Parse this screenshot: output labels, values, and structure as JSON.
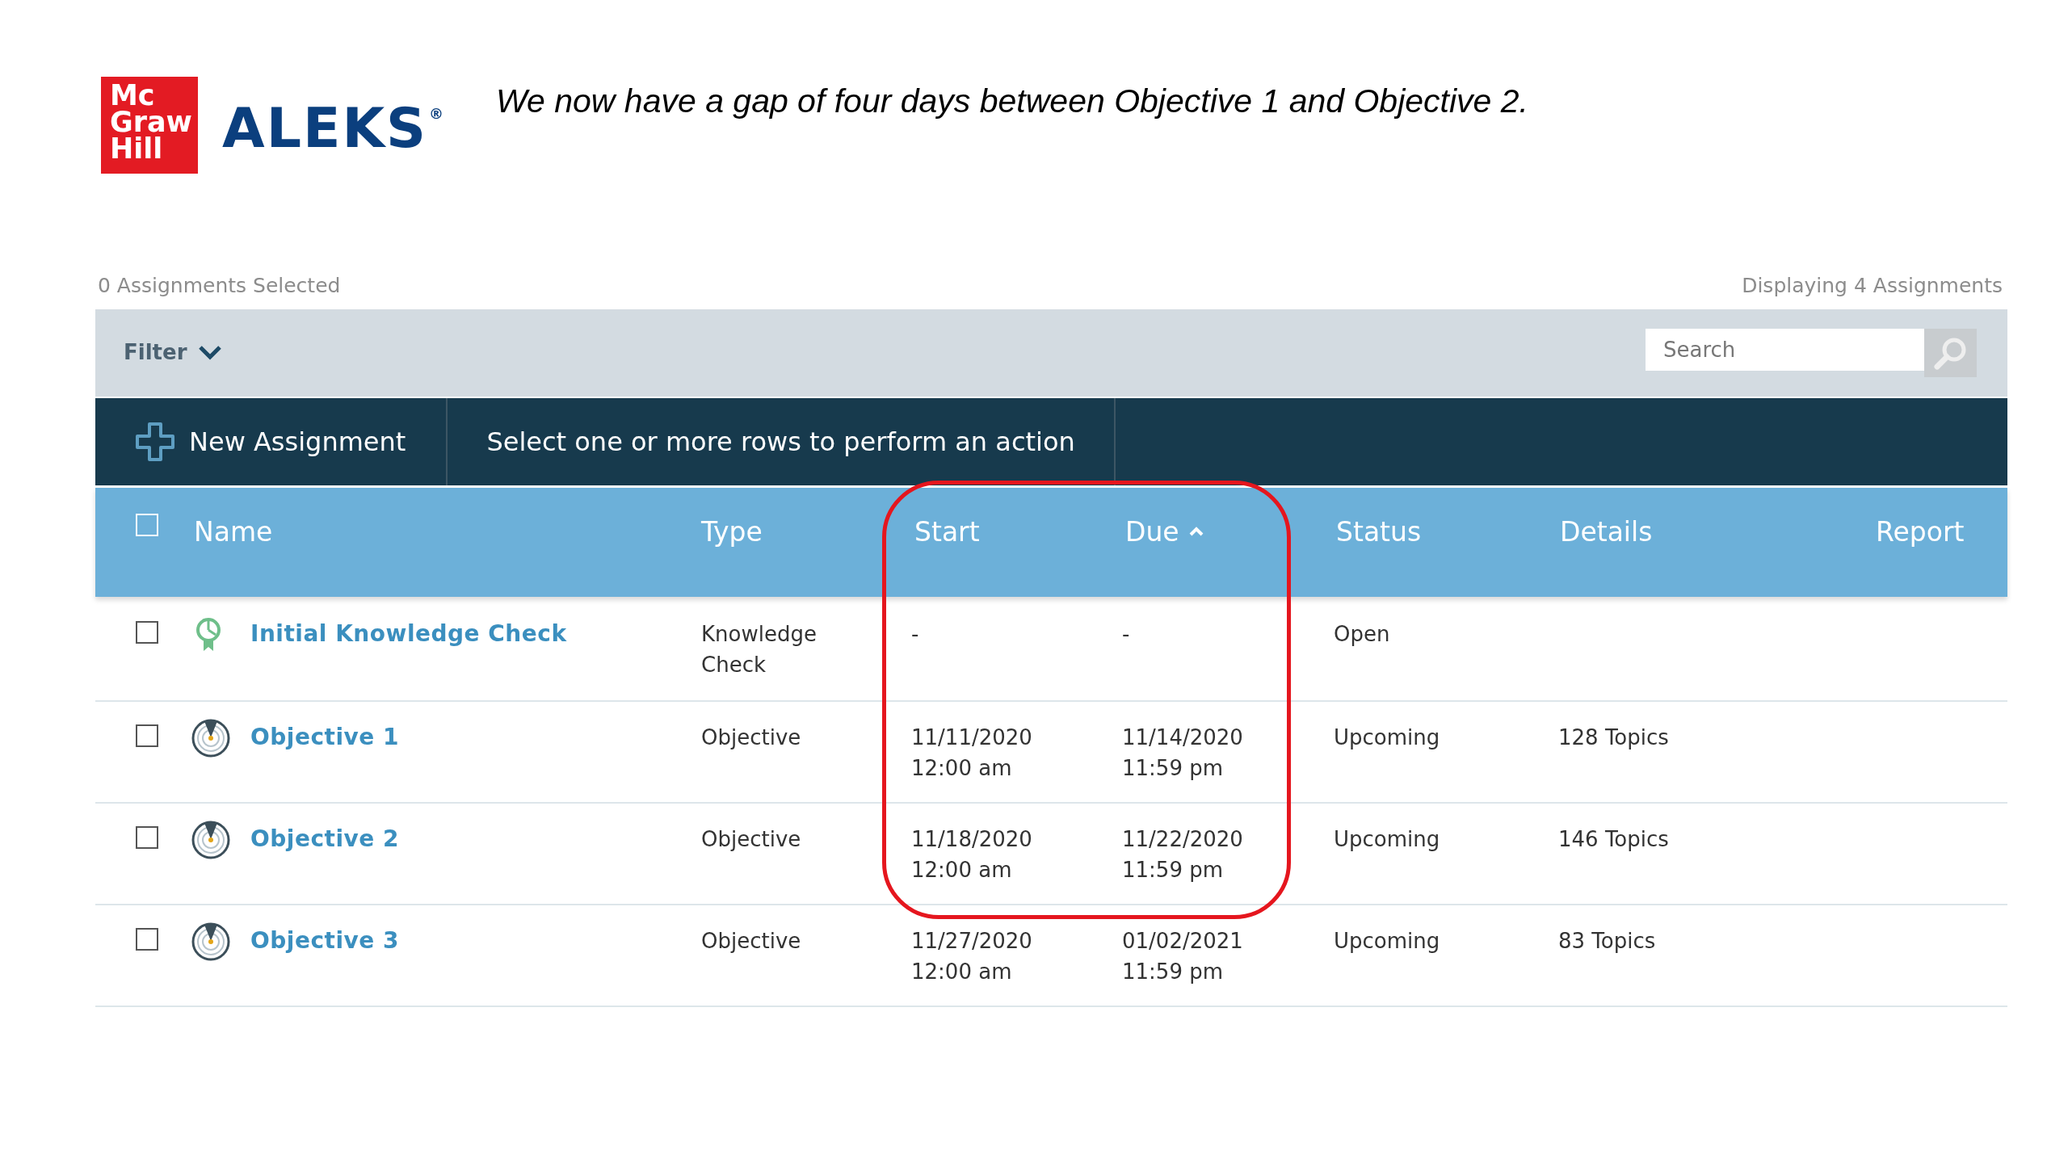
{
  "logo": {
    "publisher": [
      "Mc",
      "Graw",
      "Hill"
    ],
    "product": "ALEKS",
    "mark": "®"
  },
  "caption": "We now have a gap of four days between Objective 1 and Objective 2.",
  "summary": {
    "selected": "0 Assignments Selected",
    "displaying": "Displaying 4 Assignments"
  },
  "filter": {
    "label": "Filter",
    "expanded": false
  },
  "search": {
    "placeholder": "Search"
  },
  "toolbar": {
    "new_button": "New Assignment",
    "hint": "Select one or more rows to perform an action"
  },
  "table": {
    "select_all_checked": false,
    "columns": [
      {
        "label": "Name",
        "sorted": false
      },
      {
        "label": "Type",
        "sorted": false
      },
      {
        "label": "Start",
        "sorted": false
      },
      {
        "label": "Due",
        "sorted": true
      },
      {
        "label": "Status",
        "sorted": false
      },
      {
        "label": "Details",
        "sorted": false
      },
      {
        "label": "Report",
        "sorted": false
      }
    ],
    "rows": [
      {
        "kind": "knowledge_check",
        "checked": false,
        "name": "Initial Knowledge Check",
        "type": [
          "Knowledge",
          "Check"
        ],
        "start": [
          "-"
        ],
        "due": [
          "-"
        ],
        "status": "Open"
      },
      {
        "kind": "objective",
        "checked": false,
        "name": "Objective 1",
        "type": [
          "Objective"
        ],
        "start": [
          "11/11/2020",
          "12:00 am"
        ],
        "due": [
          "11/14/2020",
          "11:59 pm"
        ],
        "status": "Upcoming",
        "details": "128 Topics"
      },
      {
        "kind": "objective",
        "checked": false,
        "name": "Objective 2",
        "type": [
          "Objective"
        ],
        "start": [
          "11/18/2020",
          "12:00 am"
        ],
        "due": [
          "11/22/2020",
          "11:59 pm"
        ],
        "status": "Upcoming",
        "details": "146 Topics"
      },
      {
        "kind": "objective",
        "checked": false,
        "name": "Objective 3",
        "type": [
          "Objective"
        ],
        "start": [
          "11/27/2020",
          "12:00 am"
        ],
        "due": [
          "01/02/2021",
          "11:59 pm"
        ],
        "status": "Upcoming",
        "details": "83 Topics"
      }
    ]
  }
}
